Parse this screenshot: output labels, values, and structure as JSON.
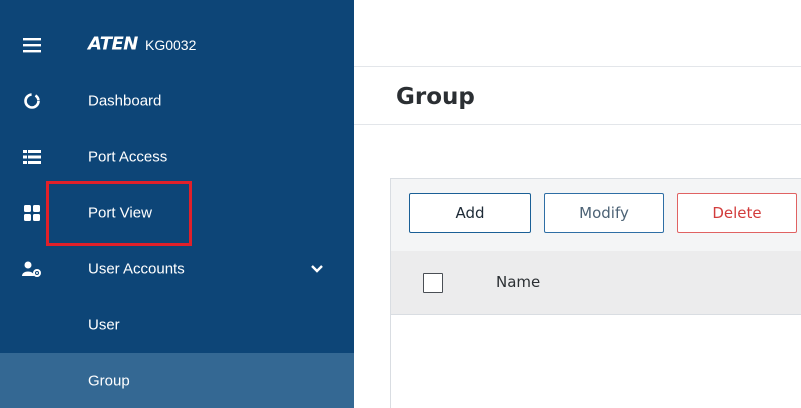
{
  "sidebar": {
    "brand": {
      "logo": "ATEN",
      "model": "KG0032"
    },
    "items": [
      {
        "label": "Dashboard",
        "icon": "dashboard-ring-icon"
      },
      {
        "label": "Port Access",
        "icon": "list-icon"
      },
      {
        "label": "Port View",
        "icon": "grid-icon"
      },
      {
        "label": "User Accounts",
        "icon": "user-gear-icon",
        "expanded": true
      },
      {
        "label": "User"
      },
      {
        "label": "Group",
        "active": true
      }
    ]
  },
  "main": {
    "title": "Group",
    "toolbar": {
      "add": "Add",
      "modify": "Modify",
      "delete": "Delete"
    },
    "table": {
      "columns": [
        "Name"
      ]
    }
  },
  "colors": {
    "sidebar_bg": "#0d4577",
    "sidebar_active": "#346893",
    "highlight": "#e0202a",
    "delete": "#d23c3c"
  }
}
